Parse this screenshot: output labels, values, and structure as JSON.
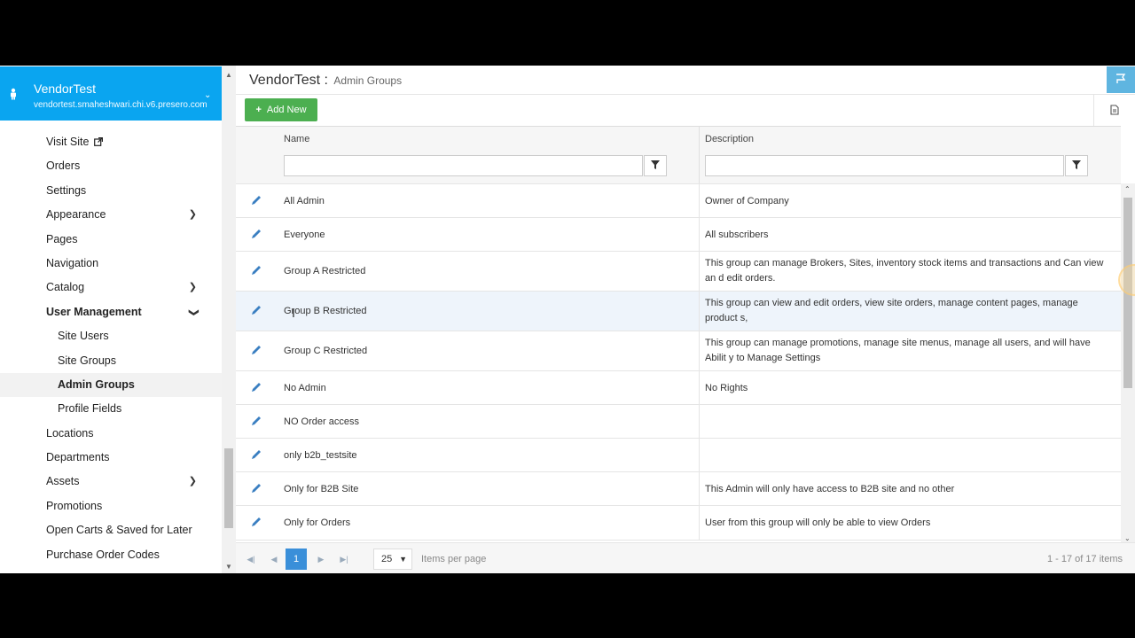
{
  "site": {
    "name": "VendorTest",
    "url": "vendortest.smaheshwari.chi.v6.presero.com"
  },
  "sidebar": {
    "items": [
      {
        "label": "Visit Site"
      },
      {
        "label": "Orders"
      },
      {
        "label": "Settings"
      },
      {
        "label": "Appearance"
      },
      {
        "label": "Pages"
      },
      {
        "label": "Navigation"
      },
      {
        "label": "Catalog"
      },
      {
        "label": "User Management"
      },
      {
        "label": "Site Users"
      },
      {
        "label": "Site Groups"
      },
      {
        "label": "Admin Groups"
      },
      {
        "label": "Profile Fields"
      },
      {
        "label": "Locations"
      },
      {
        "label": "Departments"
      },
      {
        "label": "Assets"
      },
      {
        "label": "Promotions"
      },
      {
        "label": "Open Carts & Saved for Later"
      },
      {
        "label": "Purchase Order Codes"
      }
    ]
  },
  "header": {
    "title": "VendorTest :",
    "subtitle": "Admin Groups"
  },
  "toolbar": {
    "add_label": "Add New"
  },
  "grid": {
    "columns": [
      "Name",
      "Description"
    ],
    "rows": [
      {
        "name": "All Admin",
        "desc": "Owner of Company"
      },
      {
        "name": "Everyone",
        "desc": "All subscribers"
      },
      {
        "name": "Group A Restricted",
        "desc": "This group can manage Brokers, Sites, inventory stock items and transactions and Can view an d edit orders."
      },
      {
        "name": "Group B Restricted",
        "desc": "This group can view and edit orders, view site orders, manage content pages, manage product s,"
      },
      {
        "name": "Group C Restricted",
        "desc": "This group can manage promotions, manage site menus, manage all users, and will have Abilit y to Manage Settings"
      },
      {
        "name": "No Admin",
        "desc": "No Rights"
      },
      {
        "name": "NO Order access",
        "desc": ""
      },
      {
        "name": "only b2b_testsite",
        "desc": ""
      },
      {
        "name": "Only for B2B Site",
        "desc": "This Admin will only have access to B2B site and no other"
      },
      {
        "name": "Only for Orders",
        "desc": "User from this group will only be able to view Orders"
      }
    ]
  },
  "pager": {
    "current_page": "1",
    "page_size": "25",
    "per_page_label": "Items per page",
    "info": "1 - 17 of 17 items"
  },
  "colors": {
    "brand": "#0aa5f0",
    "add_button": "#4caf50",
    "pager_active": "#3a8fd9",
    "edit_icon": "#3a7fc1"
  }
}
